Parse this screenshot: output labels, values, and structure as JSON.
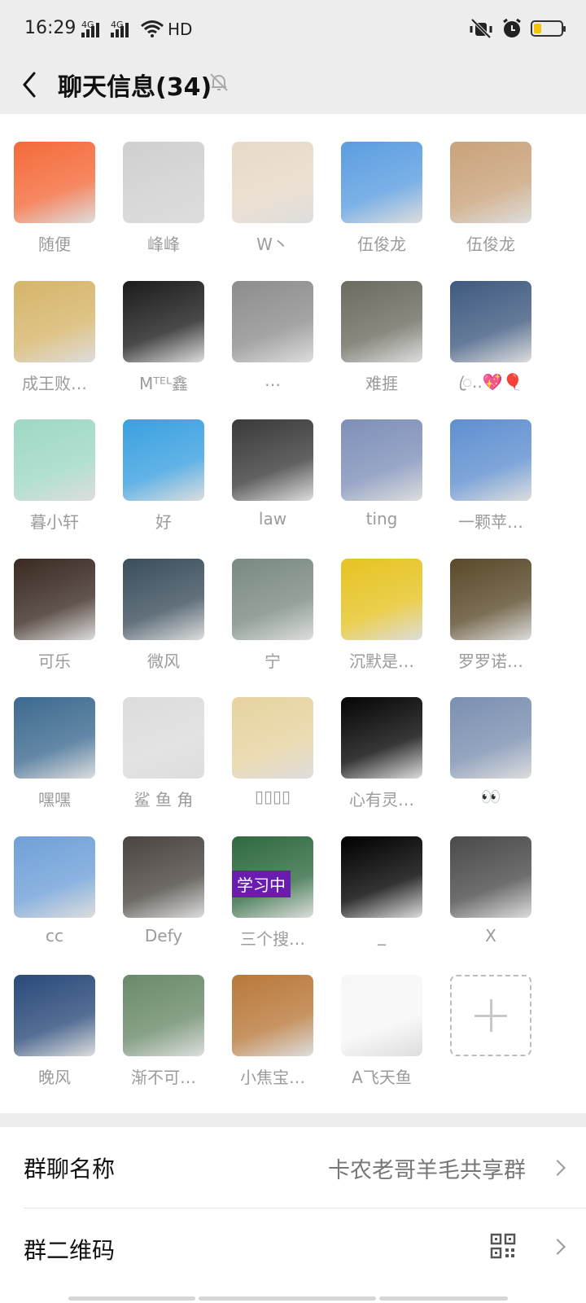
{
  "status": {
    "time": "16:29",
    "network1": "4G",
    "network2": "4G",
    "hd": "HD",
    "battery_level": 0.2
  },
  "header": {
    "title": "聊天信息(34)"
  },
  "members": [
    {
      "name": "随便",
      "color": "#f46a3a"
    },
    {
      "name": "峰峰",
      "color": "#cfcfcf"
    },
    {
      "name": "W丶",
      "color": "#e8d9c8"
    },
    {
      "name": "伍俊龙",
      "color": "#5b9de0"
    },
    {
      "name": "伍俊龙",
      "color": "#c9a27a"
    },
    {
      "name": "成王败…",
      "color": "#d6b56a"
    },
    {
      "name": "Mᵀᴱᴸ鑫",
      "color": "#1c1c1c"
    },
    {
      "name": "…",
      "color": "#8d8d8d"
    },
    {
      "name": "难捱",
      "color": "#6b6b60"
    },
    {
      "name": "ꦿ..💖🎈",
      "color": "#3f5a80"
    },
    {
      "name": "暮小轩",
      "color": "#9ed8c4"
    },
    {
      "name": "好",
      "color": "#3aa0e0"
    },
    {
      "name": "law",
      "color": "#3a3a3a"
    },
    {
      "name": "ting",
      "color": "#7e8fb8"
    },
    {
      "name": "一颗苹…",
      "color": "#5f8fd0"
    },
    {
      "name": "可乐",
      "color": "#3a2a22"
    },
    {
      "name": "微风",
      "color": "#3b4e5c"
    },
    {
      "name": "宁",
      "color": "#7a8a80"
    },
    {
      "name": "沉默是…",
      "color": "#e6c322"
    },
    {
      "name": "罗罗诺…",
      "color": "#5a4a2a"
    },
    {
      "name": "嘿嘿",
      "color": "#3d6a90"
    },
    {
      "name": "鲨 鱼 角",
      "color": "#dcdcdc"
    },
    {
      "name": "▯▯▯▯",
      "color": "#e7d3a0"
    },
    {
      "name": "心有灵…",
      "color": "#050505"
    },
    {
      "name": "👀",
      "color": "#7b8fb0"
    },
    {
      "name": "cc",
      "color": "#6fa0d8"
    },
    {
      "name": "Defy",
      "color": "#4a4540"
    },
    {
      "name": "三个搜…",
      "color": "#2f6a40",
      "badge": "学习中"
    },
    {
      "name": "_",
      "color": "#000000"
    },
    {
      "name": "X",
      "color": "#4a4a4a"
    },
    {
      "name": "晚风",
      "color": "#2a4a7a"
    },
    {
      "name": "渐不可…",
      "color": "#6a8a6a"
    },
    {
      "name": "小焦宝…",
      "color": "#b9783a"
    },
    {
      "name": "A飞天鱼",
      "color": "#f7f7f7"
    }
  ],
  "settings": {
    "group_name_label": "群聊名称",
    "group_name_value": "卡农老哥羊毛共享群",
    "qr_label": "群二维码"
  }
}
